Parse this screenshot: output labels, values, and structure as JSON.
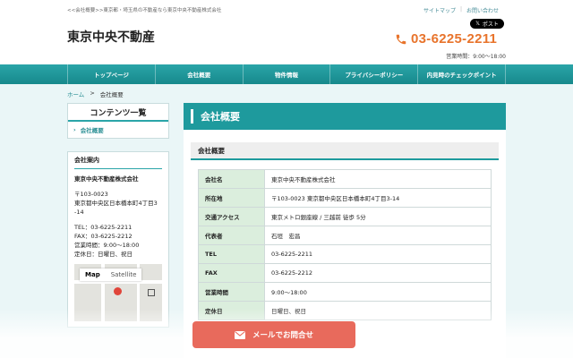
{
  "header": {
    "crumb": "<<会社概要>>東京都・埼玉県の不動産なら東京中央不動産株式会社",
    "links": [
      "サイトマップ",
      "お問い合わせ"
    ],
    "post_label": "ポスト",
    "site_title": "東京中央不動産",
    "phone": "03-6225-2211",
    "hours": "営業時間：9:00〜18:00",
    "accent": "#e8742c"
  },
  "nav": {
    "items": [
      "トップページ",
      "会社概要",
      "物件情報",
      "プライバシーポリシー",
      "内見時のチェックポイント"
    ],
    "color": "#1e9a9d"
  },
  "breadcrumb": {
    "home": "ホーム",
    "sep": ">",
    "current": "会社概要"
  },
  "sidebar": {
    "contents_title": "コンテンツ一覧",
    "contents_items": [
      "会社概要"
    ],
    "info_title": "会社案内",
    "company": "東京中央不動産株式会社",
    "postal": "〒103-0023",
    "address1": "東京都中央区日本橋本町4丁目3",
    "address2": "-14",
    "tel": "TEL：03-6225-2211",
    "fax": "FAX：03-6225-2212",
    "hours": "営業時間：9:00〜18:00",
    "holiday": "定休日：日曜日、祝日",
    "map_tabs": [
      "Map",
      "Satellite"
    ]
  },
  "main": {
    "title": "会社概要",
    "section": "会社概要",
    "rows": [
      {
        "label": "会社名",
        "value": "東京中央不動産株式会社"
      },
      {
        "label": "所在地",
        "value": "〒103-0023 東京都中央区日本橋本町4丁目3-14"
      },
      {
        "label": "交通アクセス",
        "value": "東京メトロ銀座線 / 三越前 徒歩 5分"
      },
      {
        "label": "代表者",
        "value": "石垣　宏昌"
      },
      {
        "label": "TEL",
        "value": "03-6225-2211"
      },
      {
        "label": "FAX",
        "value": "03-6225-2212"
      },
      {
        "label": "営業時間",
        "value": "9:00〜18:00"
      },
      {
        "label": "定休日",
        "value": "日曜日、祝日"
      }
    ]
  },
  "cta": {
    "label": "メールでお問合せ",
    "color": "#e86a5c"
  }
}
